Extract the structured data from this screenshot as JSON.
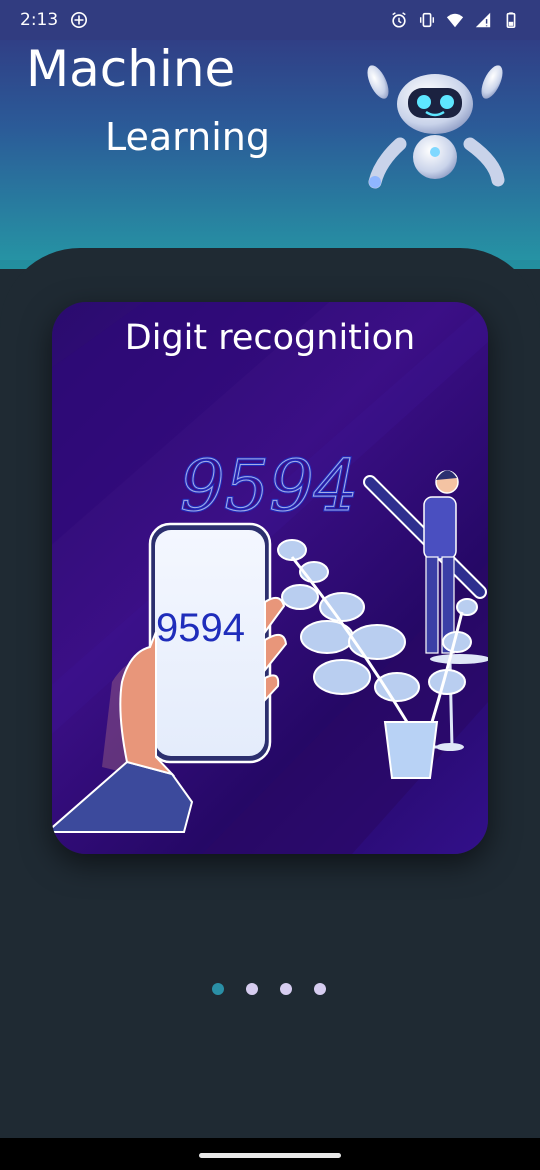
{
  "status_bar": {
    "time": "2:13",
    "icons": [
      "add-circle-icon",
      "alarm-icon",
      "vibrate-icon",
      "wifi-icon",
      "signal-icon",
      "battery-icon"
    ]
  },
  "header": {
    "title_line1": "Machine",
    "title_line2": "Learning",
    "mascot": "robot-icon"
  },
  "carousel": {
    "slide_title": "Digit recognition",
    "handwritten_number": "9594",
    "phone_number": "9594",
    "page_count": 4,
    "active_index": 0
  },
  "colors": {
    "accent": "#2a8fa6",
    "dot_inactive": "#d6cdf0",
    "background": "#1f2a33",
    "slide_bg": "#2a0b6e",
    "digits_blue": "#1f2dbb"
  }
}
